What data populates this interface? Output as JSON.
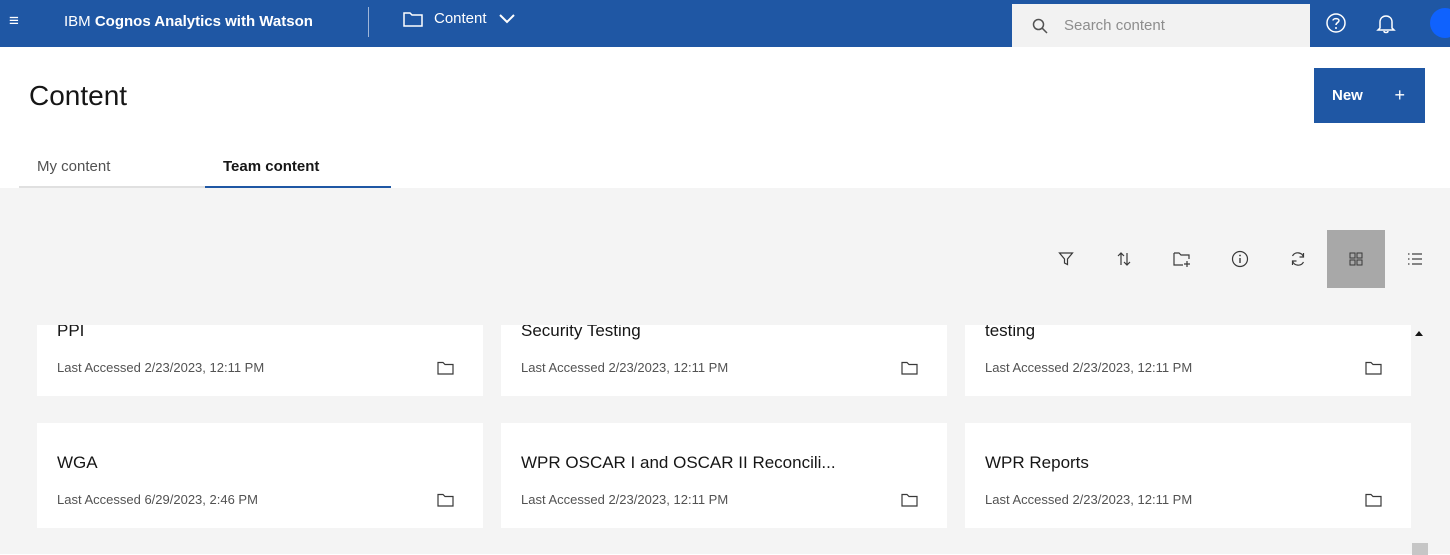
{
  "topbar": {
    "brand_prefix": "IBM",
    "brand_name": "Cognos Analytics with Watson",
    "breadcrumb_label": "Content",
    "search_placeholder": "Search content",
    "icons": [
      "menu-icon",
      "folder-icon",
      "chevron-down-icon",
      "search-icon",
      "help-icon",
      "notification-bell-icon",
      "avatar"
    ]
  },
  "header": {
    "title": "Content",
    "new_button_label": "New",
    "new_button_icon": "+"
  },
  "tabs": [
    {
      "label": "My content",
      "active": false
    },
    {
      "label": "Team content",
      "active": true
    }
  ],
  "toolbar": {
    "tools": [
      "filter-icon",
      "sort-icon",
      "new-folder-icon",
      "info-icon",
      "refresh-icon",
      "grid-view-icon",
      "list-view-icon"
    ],
    "selected_view": "grid"
  },
  "cards": [
    {
      "title": "PPI",
      "meta": "Last Accessed 2/23/2023, 12:11 PM"
    },
    {
      "title": "Security Testing",
      "meta": "Last Accessed 2/23/2023, 12:11 PM"
    },
    {
      "title": "testing",
      "meta": "Last Accessed 2/23/2023, 12:11 PM"
    },
    {
      "title": "WGA",
      "meta": "Last Accessed 6/29/2023, 2:46 PM"
    },
    {
      "title": "WPR OSCAR I and OSCAR II Reconcili...",
      "meta": "Last Accessed 2/23/2023, 12:11 PM"
    },
    {
      "title": "WPR Reports",
      "meta": "Last Accessed 2/23/2023, 12:11 PM"
    }
  ],
  "colors": {
    "brand_blue": "#1f57a4",
    "page_bg": "#f4f4f4",
    "selected_tool_bg": "#a8a8a8"
  }
}
